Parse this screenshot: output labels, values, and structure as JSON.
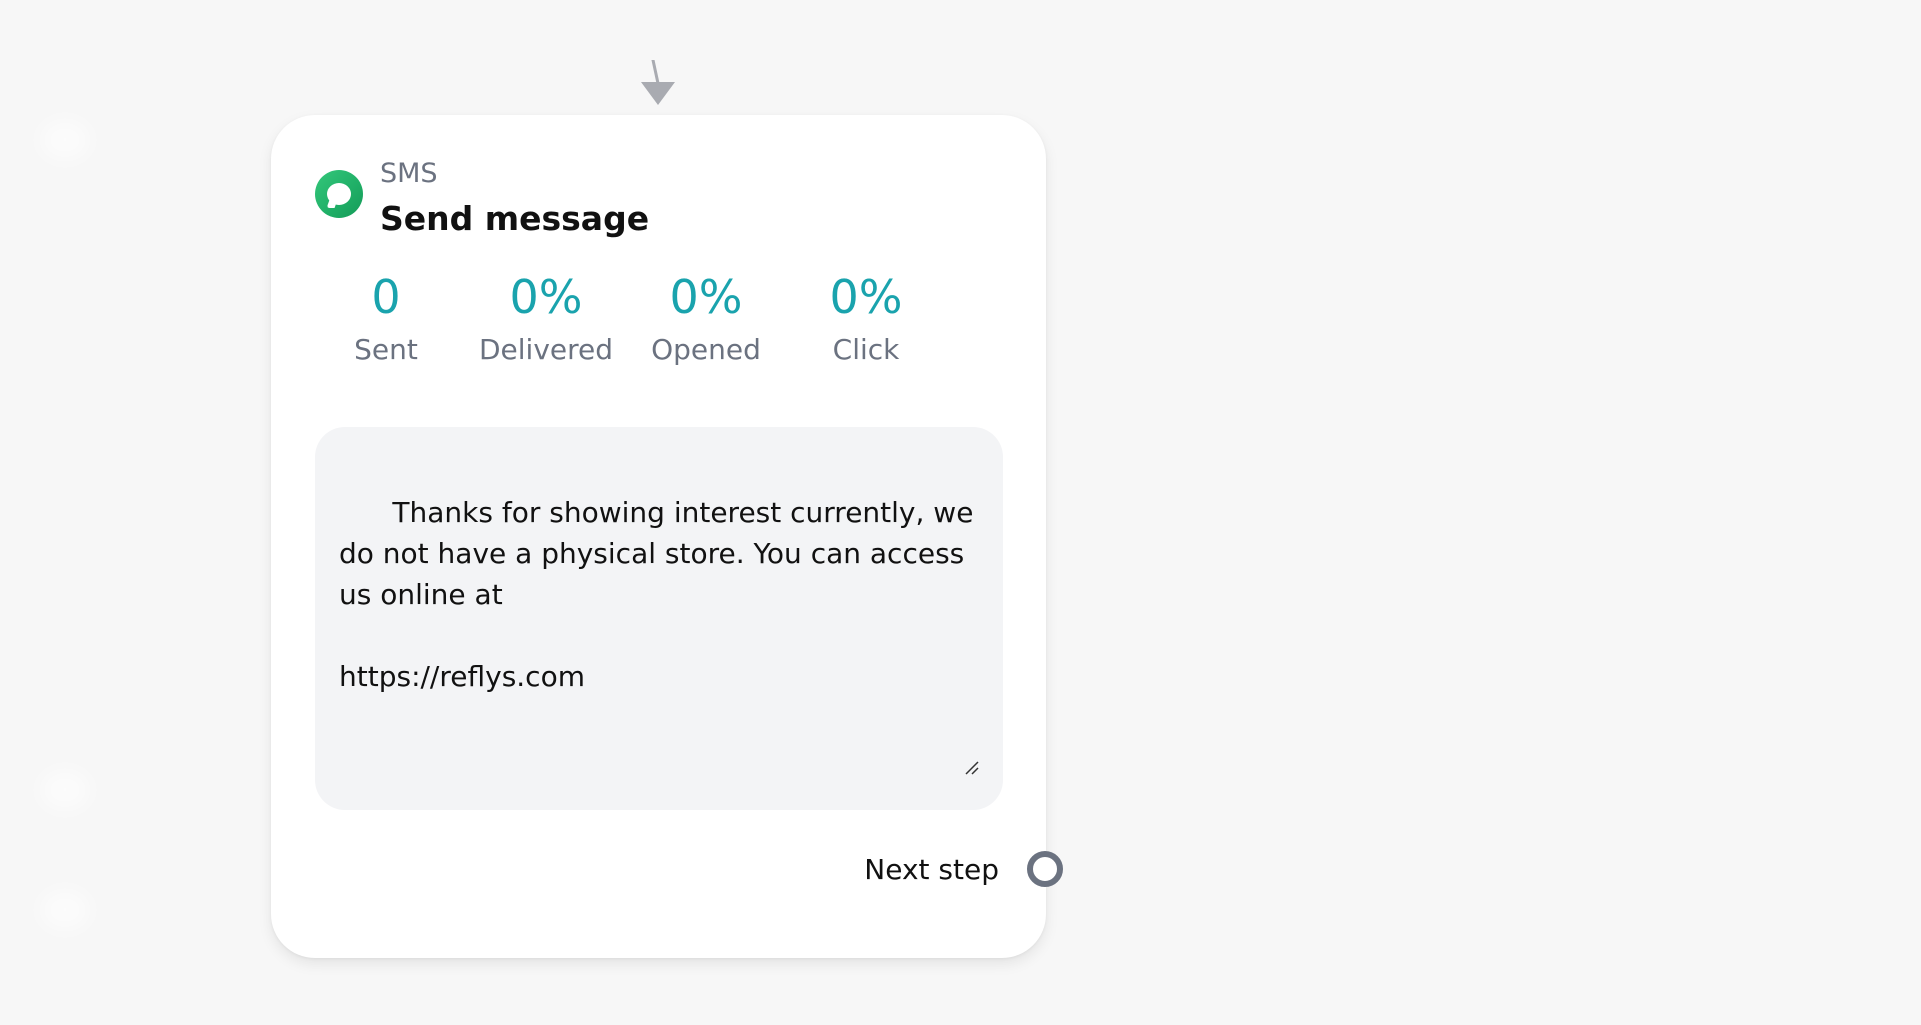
{
  "node": {
    "channel": "SMS",
    "title": "Send message",
    "stats": [
      {
        "value": "0",
        "label": "Sent"
      },
      {
        "value": "0%",
        "label": "Delivered"
      },
      {
        "value": "0%",
        "label": "Opened"
      },
      {
        "value": "0%",
        "label": "Click"
      }
    ],
    "message": "Thanks for showing interest currently, we do not have a physical store. You can access us online at\n\nhttps://reflys.com",
    "next_step_label": "Next step"
  },
  "colors": {
    "accent": "#1aa3ad",
    "sms_green": "#1fae66",
    "handle": "#6b7280",
    "background": "#f7f7f7"
  },
  "icons": {
    "channel_icon": "sms-bubble-icon",
    "incoming": "arrow-down-icon",
    "resize": "resize-grip-icon",
    "output": "connection-handle-icon"
  }
}
